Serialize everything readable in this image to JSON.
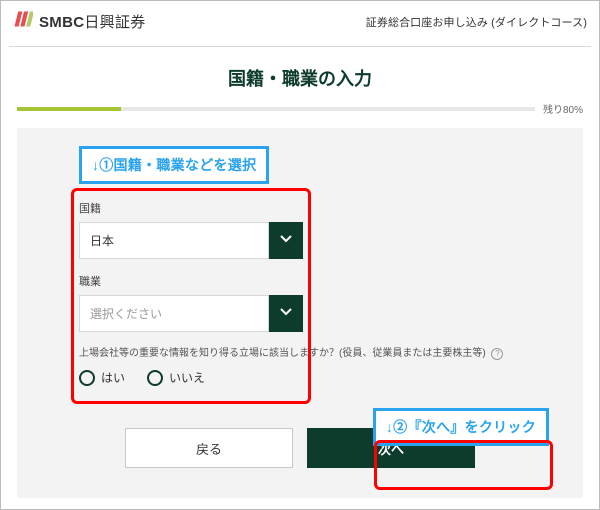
{
  "brand": {
    "logo_aria": "SMBC logo",
    "name_bold": "SMBC",
    "name_rest": "日興証券"
  },
  "header": {
    "right_text": "証券総合口座お申し込み (ダイレクトコース)"
  },
  "page": {
    "title": "国籍・職業の入力"
  },
  "progress": {
    "remaining_label": "残り80%",
    "percent_done": 20
  },
  "callouts": {
    "step1": "↓①国籍・職業などを選択",
    "step2": "↓②『次へ』をクリック"
  },
  "form": {
    "nationality": {
      "label": "国籍",
      "value": "日本"
    },
    "occupation": {
      "label": "職業",
      "placeholder": "選択ください"
    },
    "question_text": "上場会社等の重要な情報を知り得る立場に該当しますか？(役員、従業員または主要株主等)",
    "radio_yes": "はい",
    "radio_no": "いいえ"
  },
  "buttons": {
    "back": "戻る",
    "next": "次へ"
  }
}
